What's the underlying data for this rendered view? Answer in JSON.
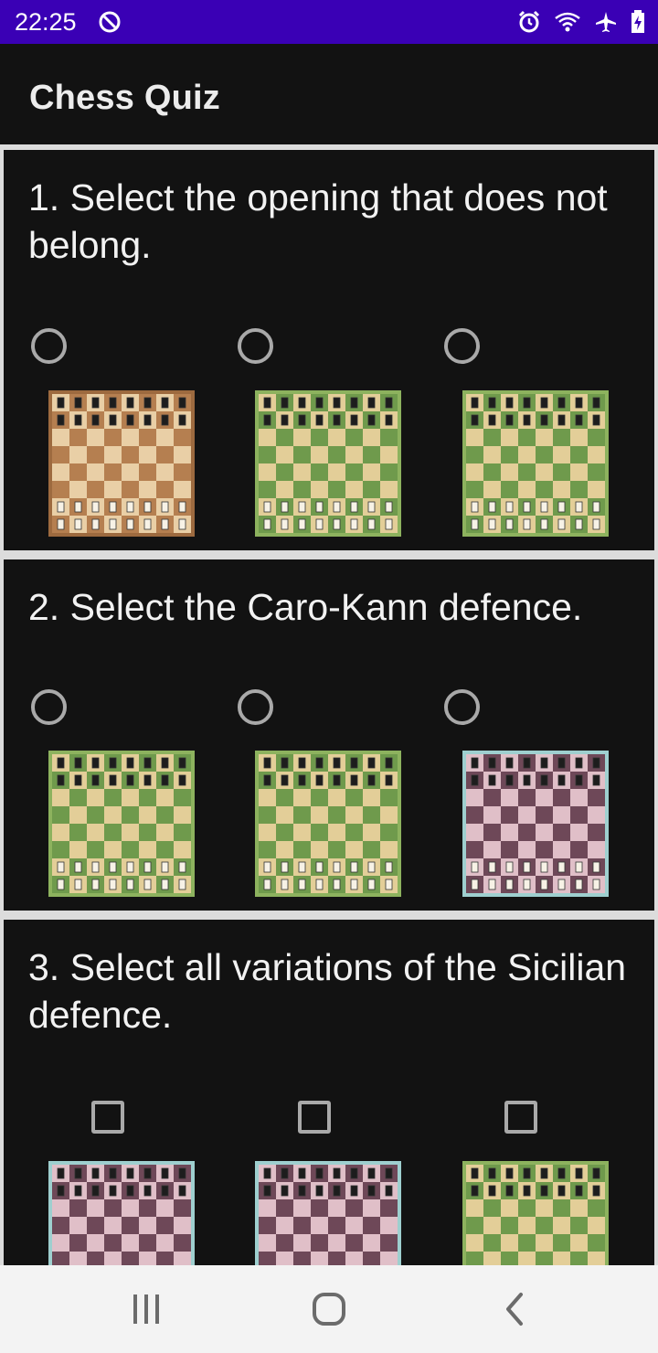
{
  "status_bar": {
    "time": "22:25",
    "icons": [
      "do-not-disturb-icon",
      "alarm-icon",
      "wifi-icon",
      "airplane-mode-icon",
      "battery-charging-icon"
    ]
  },
  "app_bar": {
    "title": "Chess Quiz"
  },
  "questions": [
    {
      "text": "1. Select the opening that does not belong.",
      "control": "radio",
      "options": [
        {
          "board_theme": "brown",
          "has_coordinates": true
        },
        {
          "board_theme": "green"
        },
        {
          "board_theme": "green"
        }
      ]
    },
    {
      "text": "2. Select the Caro-Kann defence.",
      "control": "radio",
      "options": [
        {
          "board_theme": "green"
        },
        {
          "board_theme": "green"
        },
        {
          "board_theme": "pink"
        }
      ]
    },
    {
      "text": "3. Select all variations of the Sicilian defence.",
      "control": "checkbox",
      "options": [
        {
          "board_theme": "pink"
        },
        {
          "board_theme": "pink"
        },
        {
          "board_theme": "green"
        }
      ]
    }
  ],
  "board_colors": {
    "brown": {
      "light": "#e9cfa6",
      "dark": "#b57f50",
      "frame": "#9d6a3f"
    },
    "green": {
      "light": "#e3ce98",
      "dark": "#6f9a4c",
      "frame": "#8db25e"
    },
    "pink": {
      "light": "#e0bfc8",
      "dark": "#6e4858",
      "frame": "#9ecfcf"
    }
  },
  "nav_bar": {
    "icons": [
      "recent-apps-icon",
      "home-icon",
      "back-icon"
    ]
  }
}
